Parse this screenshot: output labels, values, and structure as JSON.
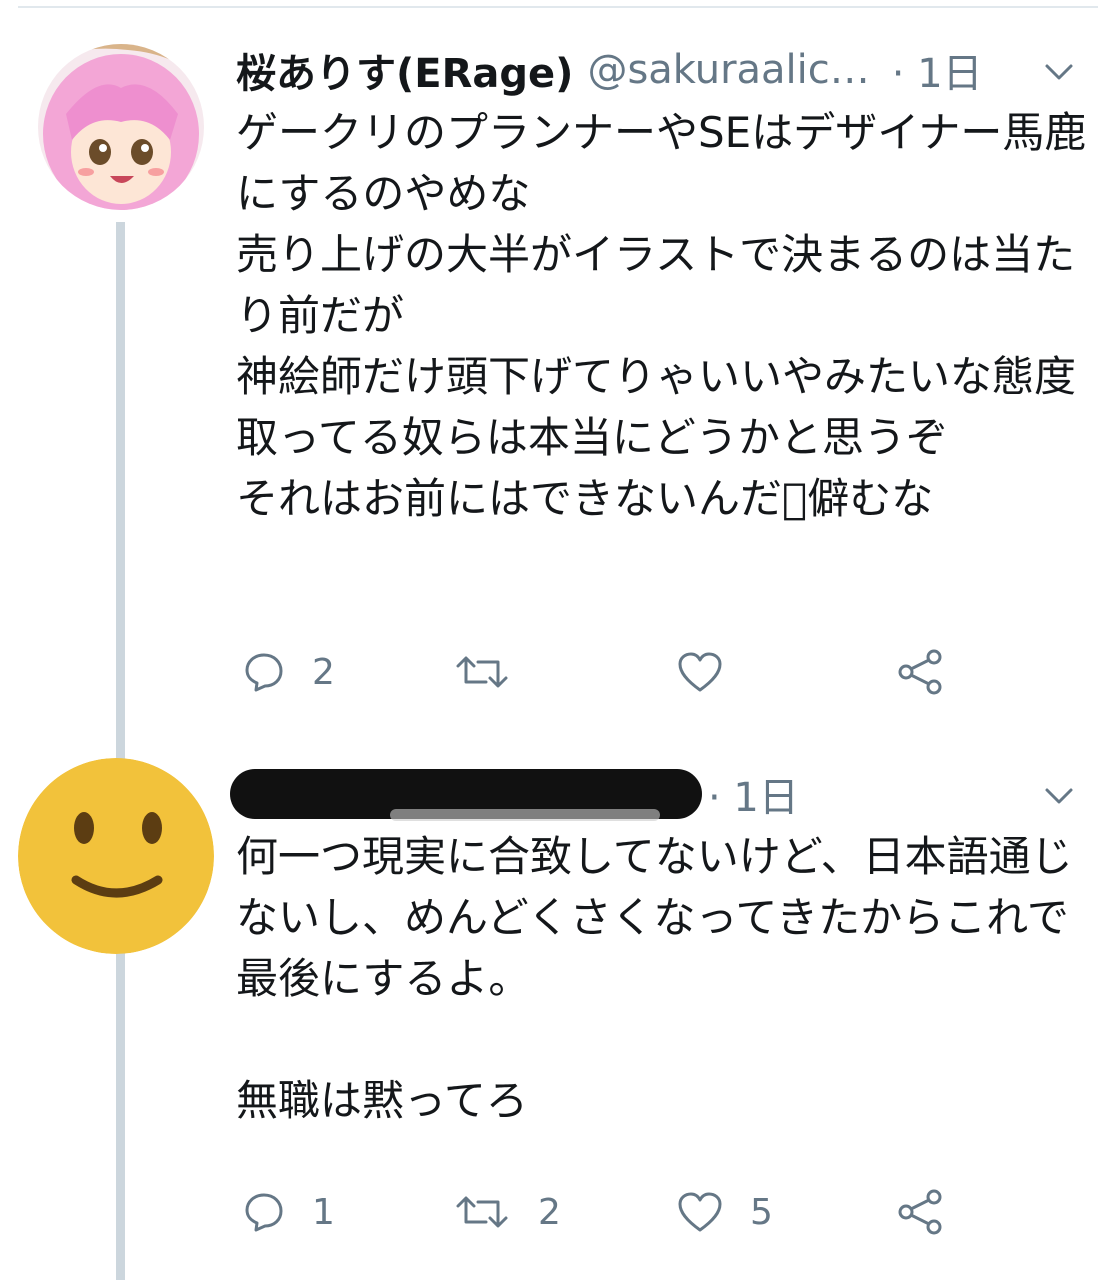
{
  "colors": {
    "text": "#14171a",
    "secondary": "#657786",
    "thread_line": "#ccd6dd",
    "emoji_face": "#f2c23b"
  },
  "tweets": [
    {
      "display_name": "桜ありす(ERage)",
      "handle": "@sakuraalic…",
      "time": "· 1日",
      "avatar": "anime-girl-avatar",
      "text": "ゲークリのプランナーやSEはデザイナー馬鹿にするのやめな\n売り上げの大半がイラストで決まるのは当たり前だが\n神絵師だけ頭下げてりゃいいやみたいな態度取ってる奴らは本当にどうかと思うぞ\nそれはお前にはできないんだ\u0000僻むな",
      "reply_count": "2",
      "retweet_count": "",
      "like_count": ""
    },
    {
      "display_name": "",
      "handle": "",
      "time": "· 1日",
      "avatar": "smiley-face-avatar",
      "text": "何一つ現実に合致してないけど、日本語通じないし、めんどくさくなってきたからこれで最後にするよ。\n\n無職は黙ってろ",
      "reply_count": "1",
      "retweet_count": "2",
      "like_count": "5"
    }
  ]
}
